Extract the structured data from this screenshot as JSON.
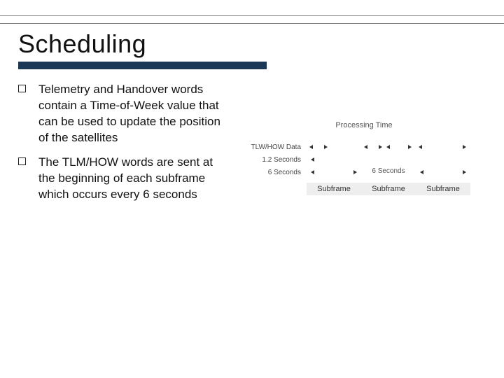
{
  "title": "Scheduling",
  "bullets": [
    "Telemetry and Handover words contain a Time-of-Week value that can be used to update the position of the satellites",
    "The TLM/HOW words are sent at the beginning of each subframe which occurs every 6 seconds"
  ],
  "figure": {
    "processing_title": "Processing Time",
    "row1_label": "TLW/HOW Data",
    "row2_label": "1.2 Seconds",
    "row3_label": "6 Seconds",
    "row3_cell": "6 Seconds",
    "subframe_label": "Subframe"
  }
}
